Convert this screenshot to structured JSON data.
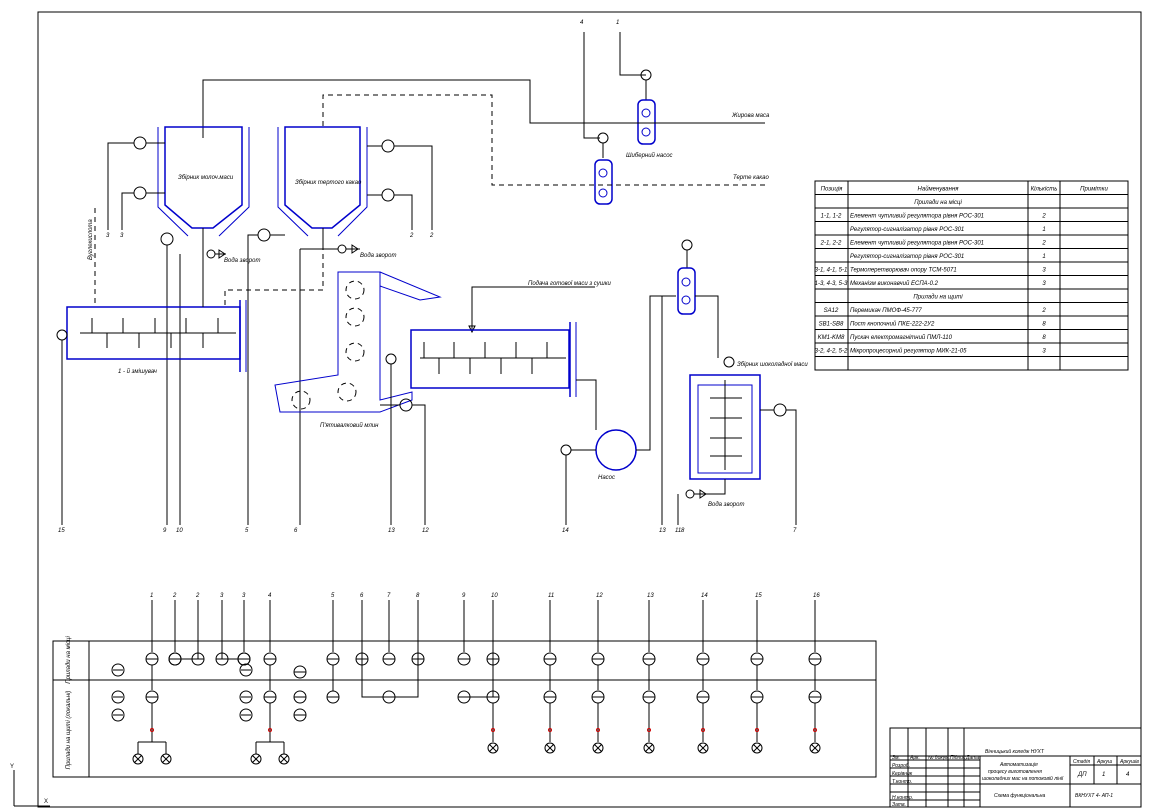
{
  "labels": {
    "vessel_milk": "Збірник молоч.маси",
    "vessel_cocoa": "Збірник тертого какао",
    "fat_mass": "Жирова маса",
    "grated_cocoa": "Терте какао",
    "dosator": "Дозатор маси",
    "from_drying": "Подача готової маси з сушки",
    "emulsifier": "1 - й змішувач",
    "mixer": "Змішувач",
    "water_supply_1": "Вода зворот",
    "water_supply_2": "Вода зворот",
    "water_supply_3": "Вода зворот",
    "pump": "Насос",
    "chocolate_vessel": "Збірник шоколадної маси",
    "five_roll": "П'ятивалковий млин",
    "carb": "Вуглекислота",
    "device_field": "Прилади на місці",
    "device_board": "Прилади на щиті"
  },
  "spec_table": {
    "headers": [
      "Позиція",
      "Найменування",
      "Кількість",
      "Примітки"
    ],
    "rows": [
      {
        "pos": "",
        "name": "Прилади на місці",
        "qty": "",
        "note": "",
        "section": true
      },
      {
        "pos": "1-1, 1-2",
        "name": "Елемент чутливий регулятора рівня РОС-301",
        "qty": "2",
        "note": ""
      },
      {
        "pos": "",
        "name": "Регулятор-сигналізатор рівня РОС-301",
        "qty": "1",
        "note": ""
      },
      {
        "pos": "2-1, 2-2",
        "name": "Елемент чутливий регулятора рівня РОС-301",
        "qty": "2",
        "note": ""
      },
      {
        "pos": "",
        "name": "Регулятор-сигналізатор рівня РОС-301",
        "qty": "1",
        "note": ""
      },
      {
        "pos": "3-1, 4-1, 5-1",
        "name": "Термоперетворювач опору ТСМ-5071",
        "qty": "3",
        "note": ""
      },
      {
        "pos": "1-3, 4-3, 5-3",
        "name": "Механізм виконавчий ЕСПА-0.2",
        "qty": "3",
        "note": ""
      },
      {
        "pos": "",
        "name": "Прилади на щиті",
        "qty": "",
        "note": "",
        "section": true
      },
      {
        "pos": "SA12",
        "name": "Перемикач ПМОФ-45-777",
        "qty": "2",
        "note": ""
      },
      {
        "pos": "SB1-SB8",
        "name": "Пост кнопочний ПКЕ-222-2У2",
        "qty": "8",
        "note": ""
      },
      {
        "pos": "KM1-KM8",
        "name": "Пускач електромагнітний ПМЛ-110",
        "qty": "8",
        "note": ""
      },
      {
        "pos": "3-2, 4-2, 5-2",
        "name": "Мікропроцесорний регулятор МИК-21-05",
        "qty": "3",
        "note": ""
      },
      {
        "pos": "",
        "name": "",
        "qty": "",
        "note": ""
      }
    ]
  },
  "bottom_panel": {
    "row1": "Прилади на місці",
    "row2": "Прилади на щиті (локальні)",
    "columns": [
      "1",
      "2",
      "2",
      "3",
      "3",
      "4",
      "5",
      "6",
      "7",
      "8",
      "9",
      "10",
      "11",
      "12",
      "13",
      "14",
      "15",
      "16"
    ]
  },
  "title_block": {
    "org": "Вінницький коледж НУХТ",
    "subject": "Автоматизація процесу виготовлення шоколадних мас на потоковій лінії",
    "sheet_title": "Схема функціональна",
    "doc_code": "ВКНУХТ 4- АП-1",
    "stage_label": "Стадія",
    "sheet_label": "Аркуш",
    "sheets_label": "Аркушів",
    "stage": "ДП",
    "sheet": "1",
    "sheets": "4",
    "roles": [
      "Зм.",
      "Розроб.",
      "Керівник",
      "Т.контр.",
      "Н.контр.",
      "Затв."
    ],
    "cols": [
      "Арк.",
      "№ докум.",
      "Підпис",
      "Дата"
    ]
  },
  "line_numbers_top": [
    "4",
    "1"
  ],
  "line_numbers_bottom": [
    "15",
    "9",
    "10",
    "5",
    "6",
    "13",
    "12",
    "14",
    "13",
    "11",
    "8",
    "7"
  ]
}
